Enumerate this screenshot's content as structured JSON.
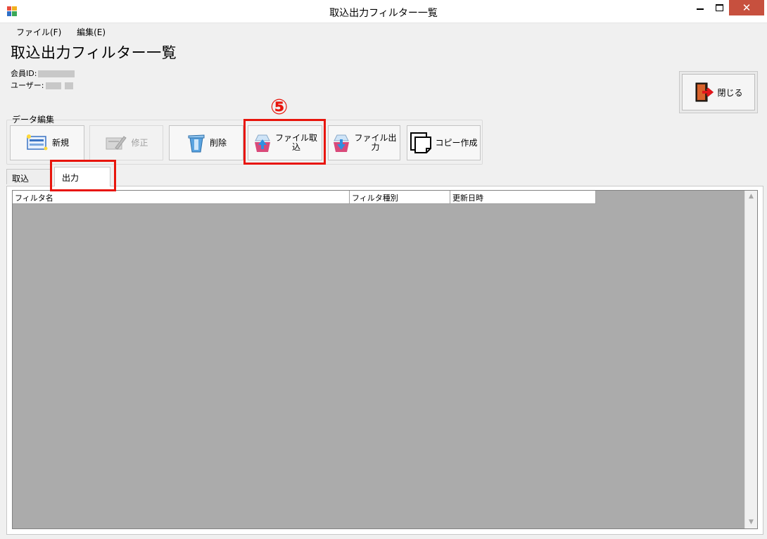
{
  "window": {
    "title": "取込出力フィルター一覧",
    "close_glyph": "✕"
  },
  "menu": {
    "items": [
      "ファイル(F)",
      "編集(E)"
    ]
  },
  "page": {
    "title": "取込出力フィルター一覧",
    "member_id_label": "会員ID:",
    "user_label": "ユーザー:"
  },
  "close_button": {
    "label": "閉じる",
    "icon": "exit-door-icon"
  },
  "toolbar": {
    "group_label": "データ編集",
    "buttons": {
      "new": {
        "label": "新規",
        "icon": "new-record-icon",
        "enabled": true
      },
      "edit": {
        "label": "修正",
        "icon": "edit-pencil-icon",
        "enabled": false
      },
      "delete": {
        "label": "削除",
        "icon": "trash-bin-icon",
        "enabled": true
      },
      "import": {
        "label_line1": "ファイル取",
        "label_line2": "込",
        "icon": "file-import-icon",
        "enabled": true
      },
      "export": {
        "label_line1": "ファイル出",
        "label_line2": "力",
        "icon": "file-export-icon",
        "enabled": true
      },
      "copy": {
        "label": "コピー作成",
        "icon": "copy-document-icon",
        "enabled": true
      }
    }
  },
  "annotation": {
    "step_marker": "⑤",
    "color": "#e8150c"
  },
  "tabs": [
    {
      "label": "取込",
      "selected": false
    },
    {
      "label": "出力",
      "selected": true
    }
  ],
  "grid": {
    "columns": [
      "フィルタ名",
      "フィルタ種別",
      "更新日時"
    ],
    "rows": [],
    "background": "#ababab"
  },
  "colors": {
    "close_button_bg": "#c7503e",
    "window_bg": "#f0f0f0"
  }
}
